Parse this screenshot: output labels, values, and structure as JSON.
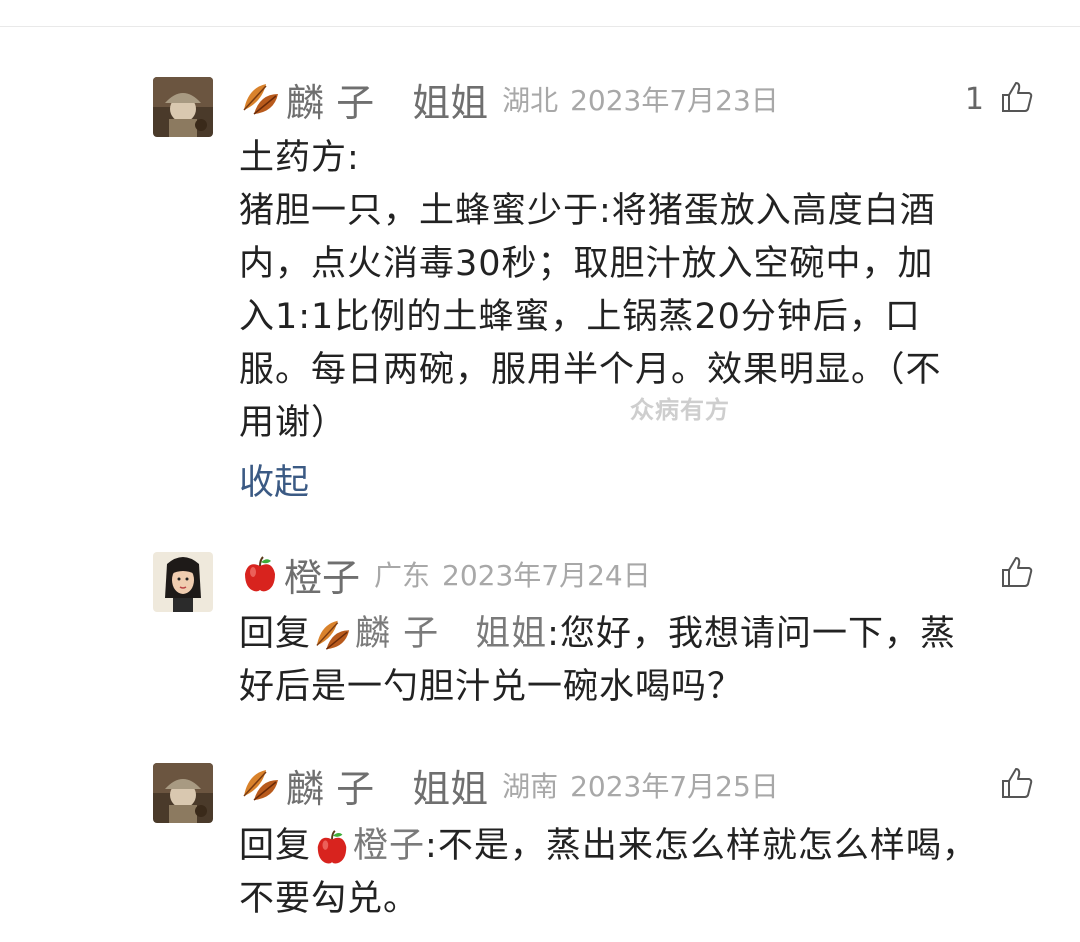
{
  "watermark": "众病有方",
  "comments": [
    {
      "nickname": "麟 子　姐姐",
      "nick_emoji": "leaf-icon",
      "location": "湖北",
      "date": "2023年7月23日",
      "like_count": "1",
      "text_lines": [
        "土药方:",
        "猪胆一只，土蜂蜜少于:将猪蛋放入高度白酒",
        "内，点火消毒30秒；取胆汁放入空碗中，加",
        "入1:1比例的土蜂蜜，上锅蒸20分钟后，口",
        "服。每日两碗，服用半个月。效果明显。（不",
        "用谢）"
      ],
      "collapse_label": "收起"
    },
    {
      "nickname": "橙子",
      "nick_emoji": "apple-icon",
      "location": "广东",
      "date": "2023年7月24日",
      "reply_prefix": "回复",
      "reply_to": "麟 子　姐姐",
      "reply_to_emoji": "leaf-icon",
      "text_first": ":您好，我想请问一下，蒸",
      "text_second": "好后是一勺胆汁兑一碗水喝吗？"
    },
    {
      "nickname": "麟 子　姐姐",
      "nick_emoji": "leaf-icon",
      "location": "湖南",
      "date": "2023年7月25日",
      "reply_prefix": "回复",
      "reply_to": "橙子",
      "reply_to_emoji": "apple-icon",
      "text_first": ":不是，蒸出来怎么样就怎么样喝，",
      "text_second": "不要勾兑。"
    }
  ],
  "colors": {
    "nickname": "#6f6f6f",
    "meta": "#a8a8a8",
    "text": "#222222",
    "link": "#3b5a84"
  }
}
